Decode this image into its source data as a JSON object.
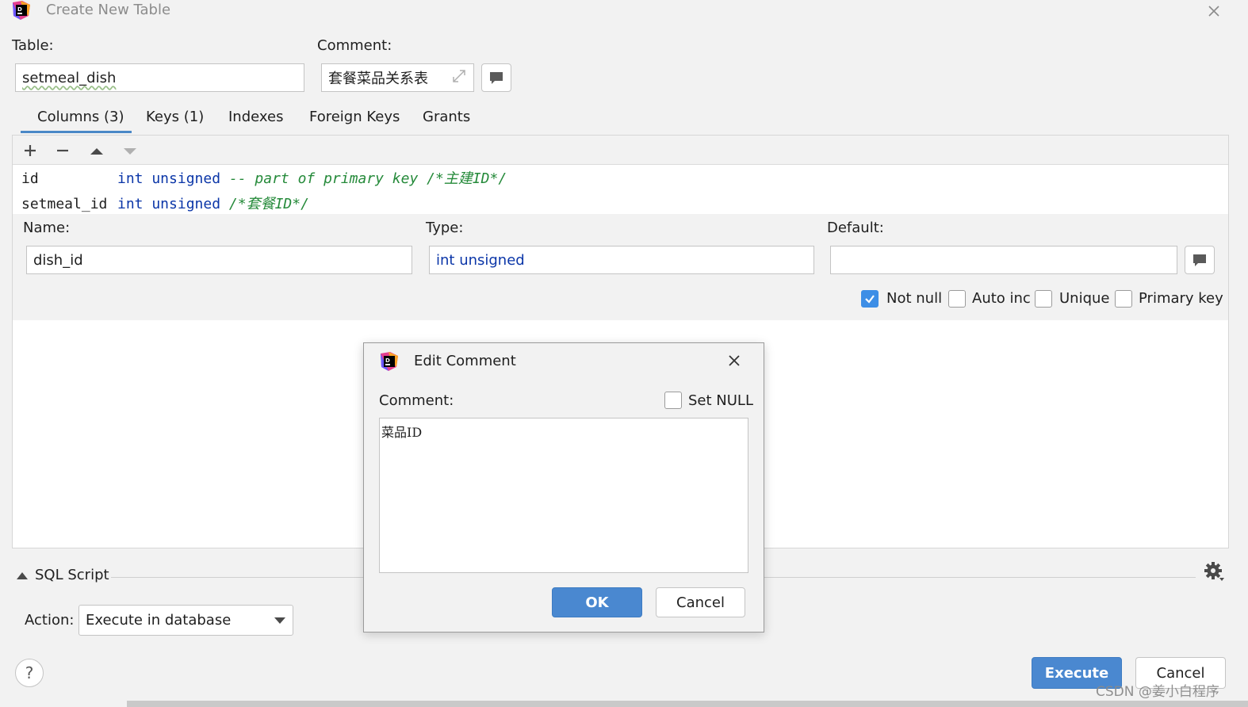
{
  "window": {
    "title": "Create New Table"
  },
  "form": {
    "table_label": "Table:",
    "table_value": "setmeal_dish",
    "comment_label": "Comment:",
    "comment_value": "套餐菜品关系表"
  },
  "tabs": [
    {
      "label": "Columns (3)",
      "active": true
    },
    {
      "label": "Keys (1)"
    },
    {
      "label": "Indexes"
    },
    {
      "label": "Foreign Keys"
    },
    {
      "label": "Grants"
    }
  ],
  "columns": [
    {
      "name": "id",
      "type": "int unsigned",
      "comment": "-- part of primary key /*主建ID*/"
    },
    {
      "name": "setmeal_id",
      "type": "int unsigned",
      "comment": "/*套餐ID*/"
    }
  ],
  "column_detail": {
    "name_label": "Name:",
    "name_value": "dish_id",
    "type_label": "Type:",
    "type_value": "int unsigned",
    "default_label": "Default:",
    "default_value": "",
    "options": [
      {
        "label": "Not null",
        "checked": true
      },
      {
        "label": "Auto inc",
        "checked": false
      },
      {
        "label": "Unique",
        "checked": false
      },
      {
        "label": "Primary key",
        "checked": false
      }
    ]
  },
  "sql_script": {
    "label": "SQL Script",
    "action_label": "Action:",
    "action_value": "Execute in database"
  },
  "footer": {
    "help": "?",
    "execute_label": "Execute",
    "cancel_label": "Cancel",
    "watermark": "CSDN @姜小白程序"
  },
  "dialog": {
    "title": "Edit Comment",
    "comment_label": "Comment:",
    "set_null_label": "Set NULL",
    "comment_text": "菜品ID",
    "ok_label": "OK",
    "cancel_label": "Cancel"
  },
  "colors": {
    "accent": "#4a88d0",
    "keyword": "#0b36a8",
    "comment": "#258a3a",
    "checkbox_checked": "#3d8ee6"
  }
}
